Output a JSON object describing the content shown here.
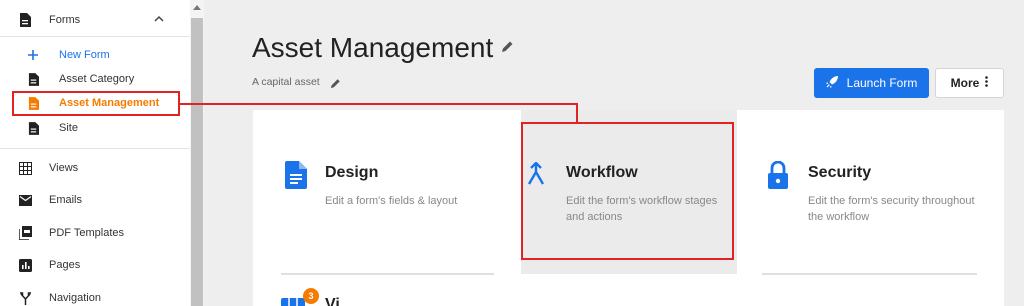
{
  "sidebar": {
    "section": {
      "label": "Forms",
      "icon": "document-icon"
    },
    "new_form": "New Form",
    "forms": [
      {
        "label": "Asset Category",
        "active": false
      },
      {
        "label": "Asset Management",
        "active": true
      },
      {
        "label": "Site",
        "active": false
      }
    ],
    "nav": [
      {
        "label": "Views",
        "icon": "grid-icon"
      },
      {
        "label": "Emails",
        "icon": "mail-icon"
      },
      {
        "label": "PDF Templates",
        "icon": "pdf-icon"
      },
      {
        "label": "Pages",
        "icon": "pages-icon"
      },
      {
        "label": "Navigation",
        "icon": "navigation-icon"
      }
    ]
  },
  "header": {
    "title": "Asset Management",
    "subtitle": "A capital asset",
    "launch_label": "Launch Form",
    "more_label": "More"
  },
  "cards": [
    {
      "title": "Design",
      "description": "Edit a form's fields & layout",
      "icon": "document-icon"
    },
    {
      "title": "Workflow",
      "description": "Edit the form's workflow stages and actions",
      "icon": "merge-icon"
    },
    {
      "title": "Security",
      "description": "Edit the form's security throughout the workflow",
      "icon": "lock-icon"
    }
  ],
  "partial_card": {
    "title": "Vi",
    "badge": "3",
    "icon": "views-icon"
  },
  "colors": {
    "accent": "#1a73e8",
    "active": "#f57c00",
    "highlight": "#e02424"
  }
}
